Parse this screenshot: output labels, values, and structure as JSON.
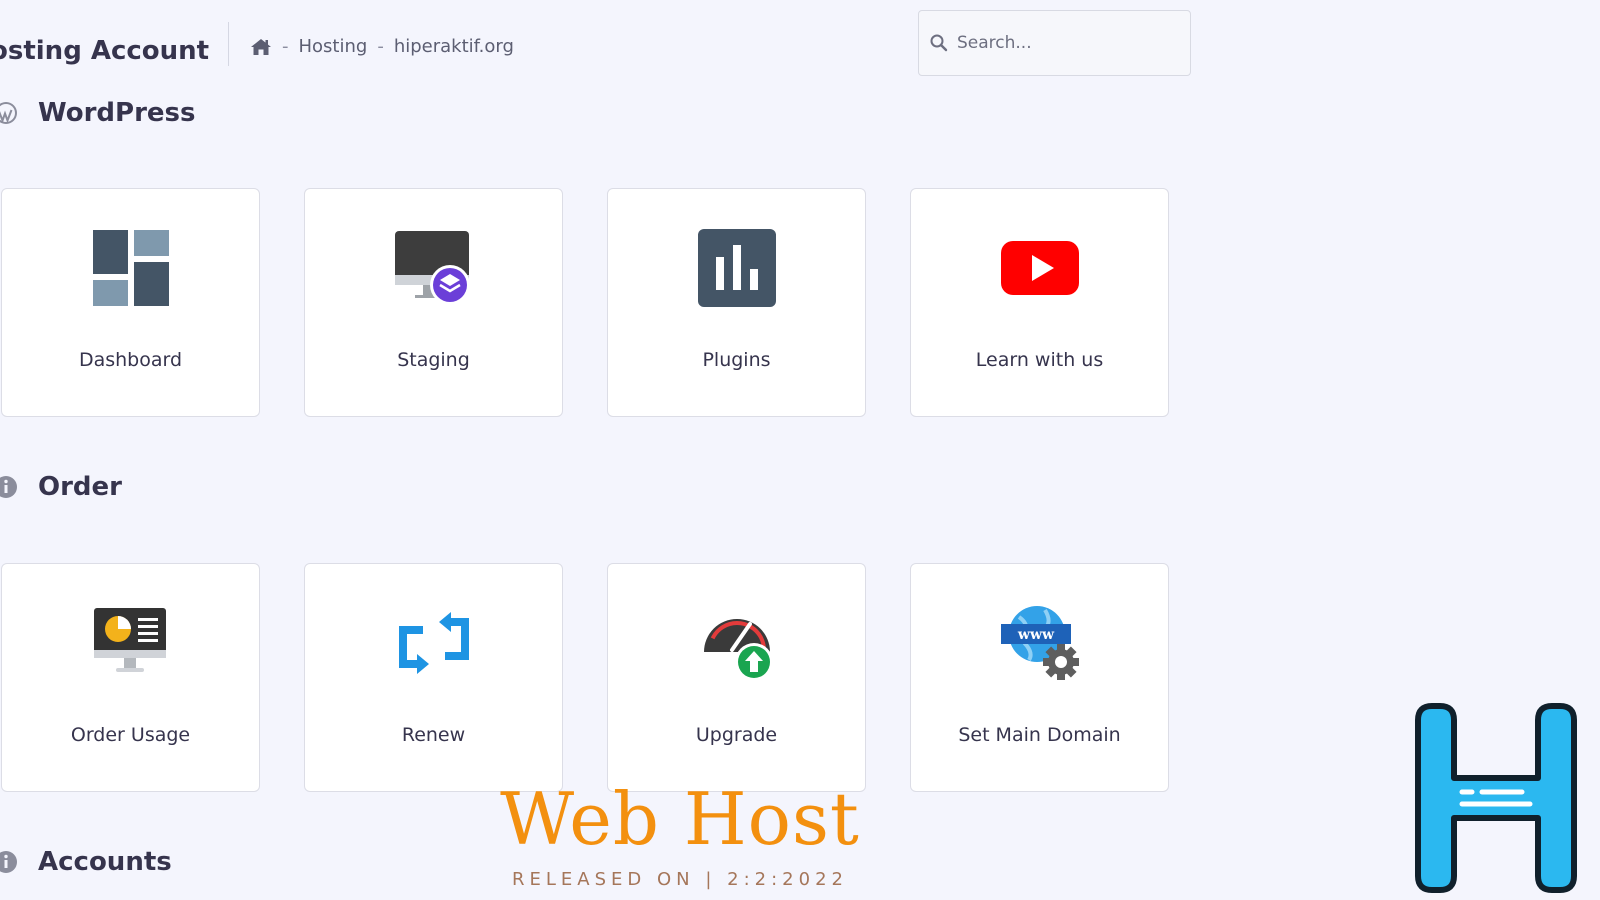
{
  "header": {
    "title": "osting Account",
    "breadcrumb": {
      "items": [
        "Hosting",
        "hiperaktif.org"
      ],
      "separator": "-"
    },
    "search": {
      "placeholder": "Search..."
    }
  },
  "sections": [
    {
      "title": "WordPress",
      "icon": "wordpress-icon",
      "cards": [
        {
          "label": "Dashboard",
          "icon": "dashboard-icon"
        },
        {
          "label": "Staging",
          "icon": "staging-icon"
        },
        {
          "label": "Plugins",
          "icon": "plugins-icon"
        },
        {
          "label": "Learn with us",
          "icon": "youtube-icon"
        }
      ]
    },
    {
      "title": "Order",
      "icon": "info-icon",
      "cards": [
        {
          "label": "Order Usage",
          "icon": "order-usage-icon"
        },
        {
          "label": "Renew",
          "icon": "renew-icon"
        },
        {
          "label": "Upgrade",
          "icon": "upgrade-icon"
        },
        {
          "label": "Set Main Domain",
          "icon": "set-main-domain-icon"
        }
      ]
    },
    {
      "title": "Accounts",
      "icon": "info-icon"
    }
  ],
  "watermark": {
    "title": "Web Host",
    "subtitle": "RELEASED ON | 2:2:2022",
    "logo_letter": "H"
  },
  "colors": {
    "background": "#f4f5fd",
    "text": "#36344d",
    "accent_orange": "#f3900f",
    "logo_blue": "#2bb8f0",
    "youtube_red": "#ff0000"
  }
}
